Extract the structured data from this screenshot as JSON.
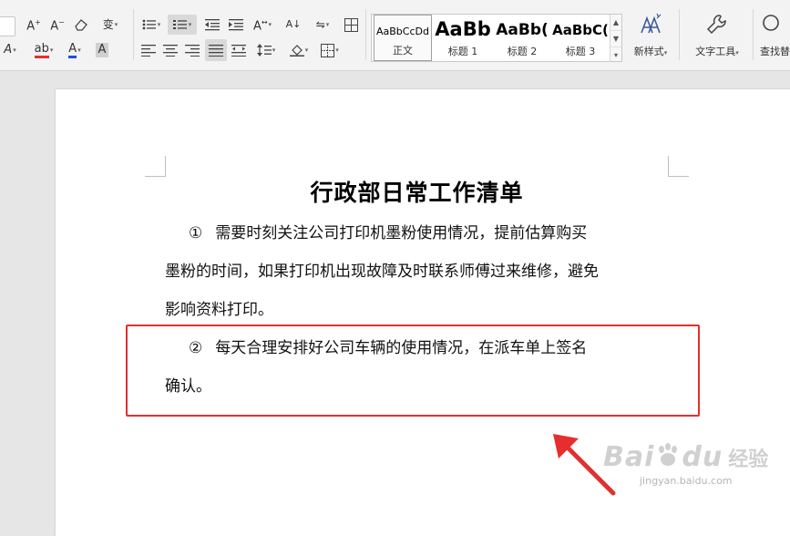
{
  "ribbon": {
    "font_size_value": "",
    "styles": [
      {
        "sample": "AaBbCcDd",
        "caption": "正文"
      },
      {
        "sample": "AaBb",
        "caption": "标题 1"
      },
      {
        "sample": "AaBb(",
        "caption": "标题 2"
      },
      {
        "sample": "AaBbC(",
        "caption": "标题 3"
      }
    ],
    "new_style_label": "新样式",
    "text_tools_label": "文字工具",
    "find_replace_label": "查找替"
  },
  "document": {
    "title": "行政部日常工作清单",
    "paragraph1": {
      "number": "①",
      "line1": "需要时刻关注公司打印机墨粉使用情况，提前估算购买",
      "line2": "墨粉的时间，如果打印机出现故障及时联系师傅过来维修，避免",
      "line3": "影响资料打印。"
    },
    "paragraph2": {
      "number": "②",
      "line1": "每天合理安排好公司车辆的使用情况，在派车单上签名",
      "line2": "确认。"
    }
  },
  "annotation": {
    "box_color": "#e62e2e",
    "arrow_color": "#e62e2e"
  },
  "watermark": {
    "brand": "Bai",
    "brand2": "du",
    "cn": "经验",
    "url": "jingyan.baidu.com"
  }
}
